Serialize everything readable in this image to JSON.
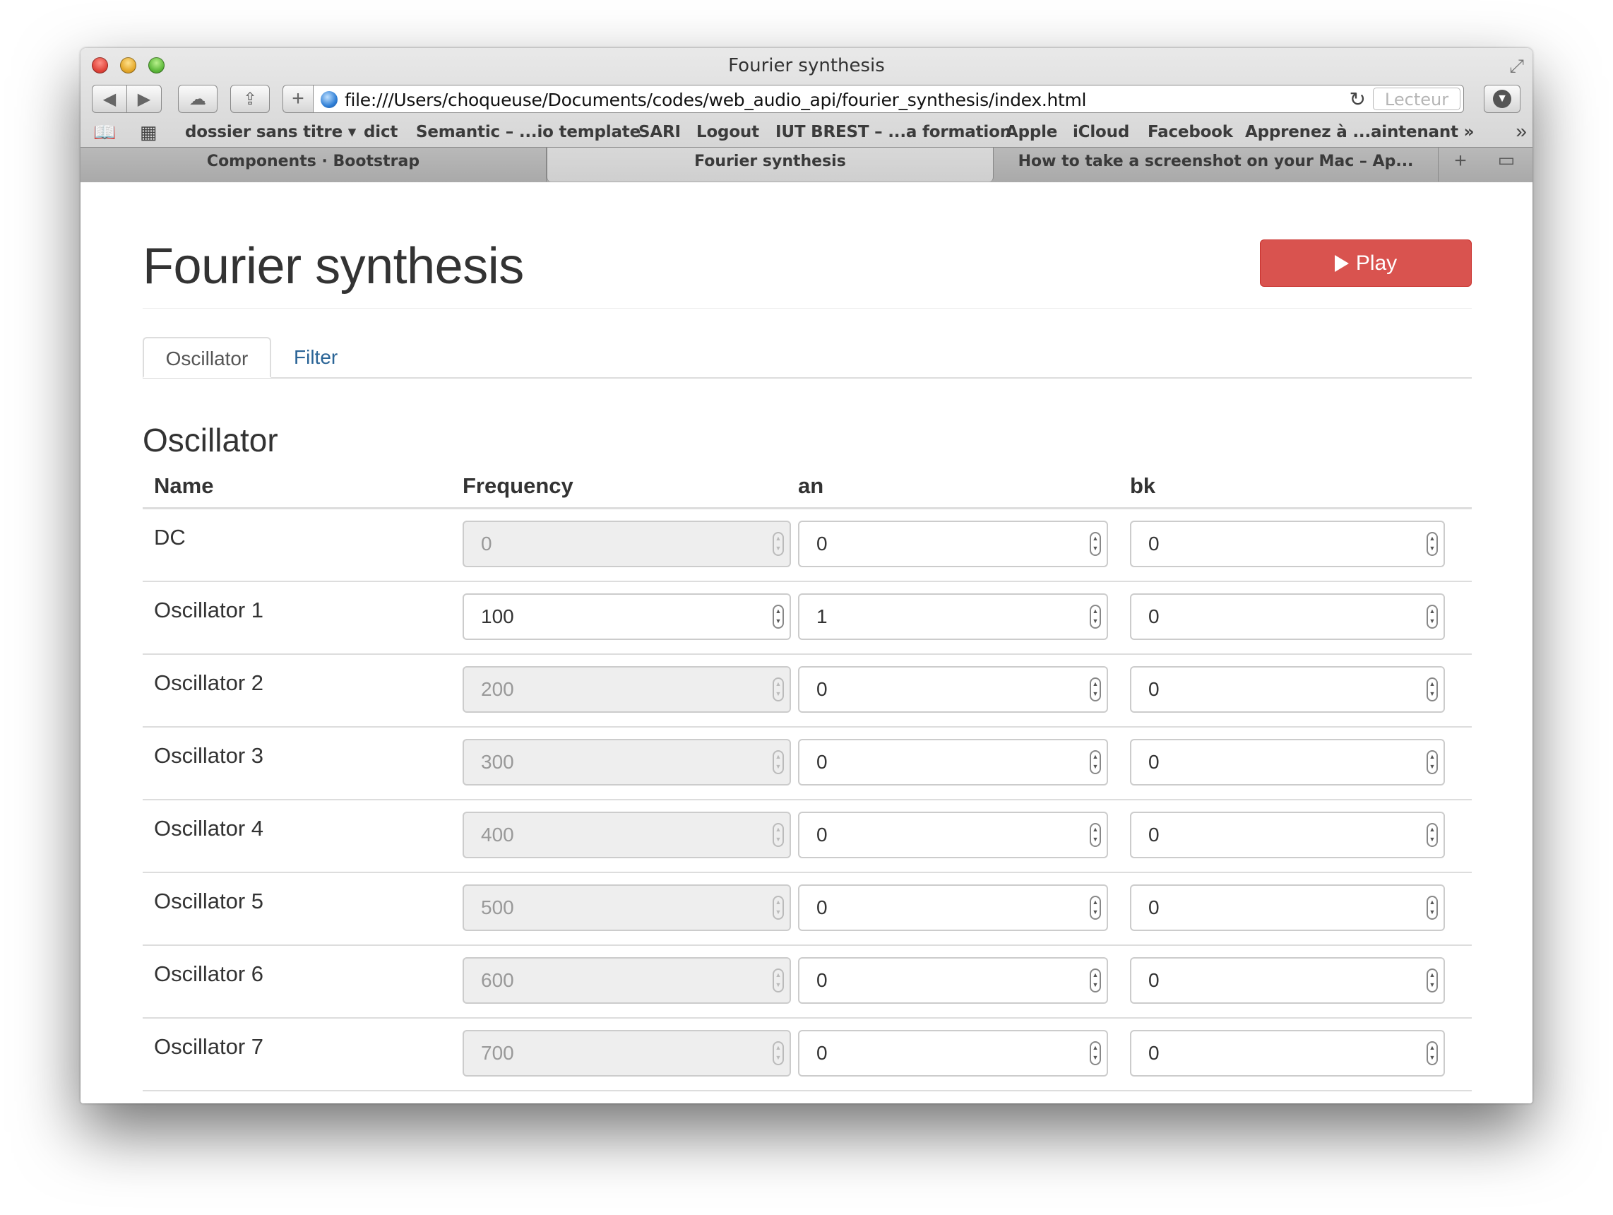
{
  "window": {
    "title": "Fourier synthesis"
  },
  "toolbar": {
    "url": "file:///Users/choqueuse/Documents/codes/web_audio_api/fourier_synthesis/index.html",
    "reader_label": "Lecteur"
  },
  "bookmarks": [
    "dossier sans titre ▾",
    "dict",
    "Semantic – ...io template",
    "SARI",
    "Logout",
    "IUT BREST – ...a formation",
    "Apple",
    "iCloud",
    "Facebook",
    "Apprenez à ...aintenant »"
  ],
  "browser_tabs": [
    "Components · Bootstrap",
    "Fourier synthesis",
    "How to take a screenshot on your Mac – Ap..."
  ],
  "page": {
    "title": "Fourier synthesis",
    "play_label": "Play",
    "tabs": [
      "Oscillator",
      "Filter"
    ],
    "section_title": "Oscillator",
    "columns": [
      "Name",
      "Frequency",
      "an",
      "bk"
    ],
    "rows": [
      {
        "name": "DC",
        "frequency": "0",
        "an": "0",
        "bk": "0",
        "frequency_disabled": true
      },
      {
        "name": "Oscillator 1",
        "frequency": "100",
        "an": "1",
        "bk": "0",
        "frequency_disabled": false
      },
      {
        "name": "Oscillator 2",
        "frequency": "200",
        "an": "0",
        "bk": "0",
        "frequency_disabled": true
      },
      {
        "name": "Oscillator 3",
        "frequency": "300",
        "an": "0",
        "bk": "0",
        "frequency_disabled": true
      },
      {
        "name": "Oscillator 4",
        "frequency": "400",
        "an": "0",
        "bk": "0",
        "frequency_disabled": true
      },
      {
        "name": "Oscillator 5",
        "frequency": "500",
        "an": "0",
        "bk": "0",
        "frequency_disabled": true
      },
      {
        "name": "Oscillator 6",
        "frequency": "600",
        "an": "0",
        "bk": "0",
        "frequency_disabled": true
      },
      {
        "name": "Oscillator 7",
        "frequency": "700",
        "an": "0",
        "bk": "0",
        "frequency_disabled": true
      }
    ]
  },
  "colors": {
    "play_button": "#d9534f",
    "link": "#2a6496"
  }
}
